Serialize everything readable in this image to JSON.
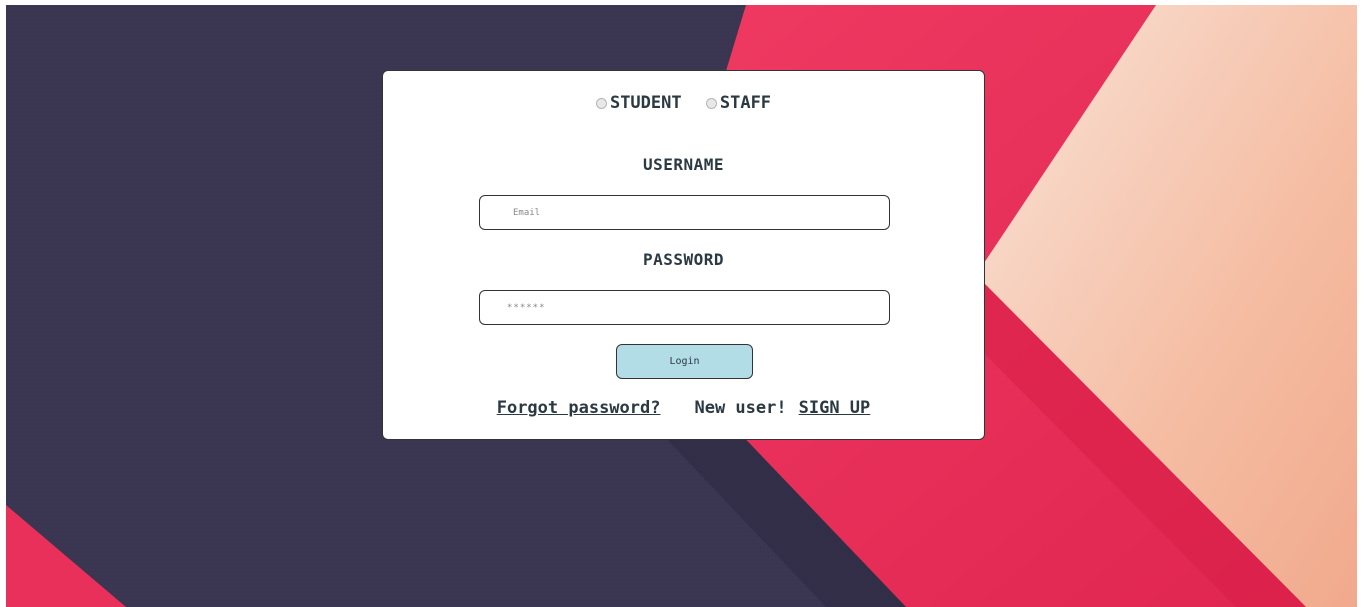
{
  "colors": {
    "background_dark": "#3a3550",
    "background_pink": "#e8305a",
    "background_peach": "#f5c0a8",
    "card": "#ffffff",
    "text": "#2b3a42",
    "button": "#b3dde6"
  },
  "login_form": {
    "roles": [
      {
        "label": "STUDENT",
        "selected": false
      },
      {
        "label": "STAFF",
        "selected": false
      }
    ],
    "username_label": "USERNAME",
    "email_placeholder": "Email",
    "password_label": "PASSWORD",
    "password_value": "******",
    "login_button": "Login",
    "forgot_password": "Forgot password?",
    "new_user_text": "New user!",
    "signup_link": "SIGN UP"
  }
}
